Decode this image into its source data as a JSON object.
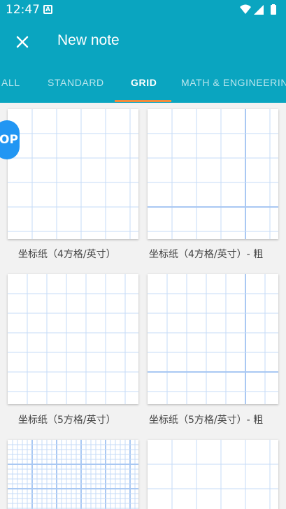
{
  "status_bar": {
    "time": "12:47",
    "notification_glyph": "A"
  },
  "toolbar": {
    "title": "New note",
    "close_icon": "close-icon"
  },
  "tabs": [
    {
      "label": "ALL",
      "active": false
    },
    {
      "label": "STANDARD",
      "active": false
    },
    {
      "label": "GRID",
      "active": true
    },
    {
      "label": "MATH & ENGINEERING",
      "active": false
    }
  ],
  "templates": [
    {
      "label": "坐标纸（4方格/英寸）"
    },
    {
      "label": "坐标纸（4方格/英寸）- 粗"
    },
    {
      "label": "坐标纸（5方格/英寸）"
    },
    {
      "label": "坐标纸（5方格/英寸）- 粗"
    },
    {
      "label": ""
    },
    {
      "label": ""
    }
  ],
  "badge": {
    "text": "OP"
  },
  "colors": {
    "appbar": "#0aa5c0",
    "indicator": "#f38a3a",
    "grid_line": "#c6dbf7",
    "grid_bold": "#a9c8f3",
    "badge": "#2196f3"
  }
}
